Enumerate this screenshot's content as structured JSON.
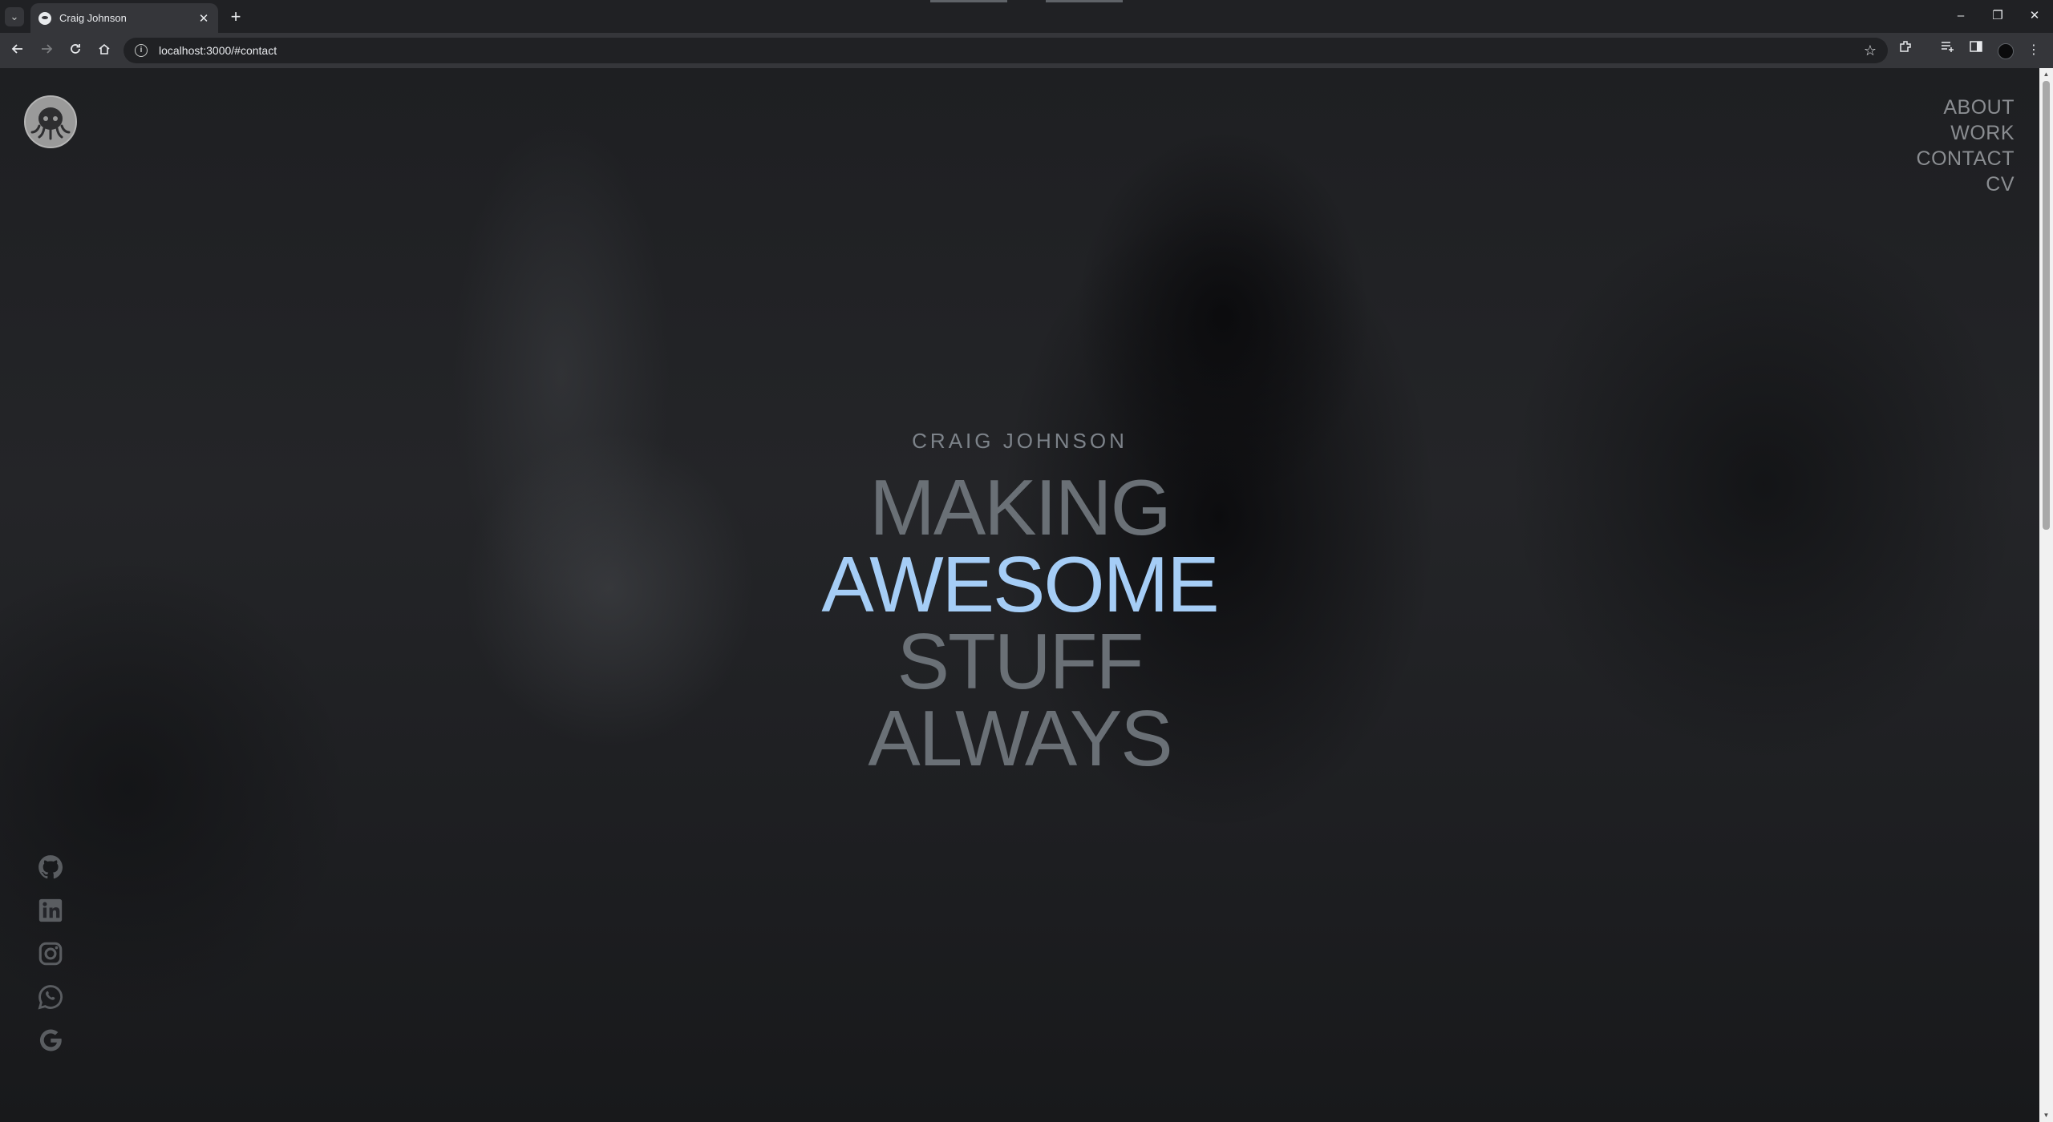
{
  "browser": {
    "tab_title": "Craig Johnson",
    "url": "localhost:3000/#contact",
    "tab_search_icon": "chevron-down-icon",
    "close_tab_symbol": "✕",
    "new_tab_symbol": "+",
    "window_controls": [
      "–",
      "❐",
      "✕"
    ]
  },
  "site": {
    "logo_icon": "octopus-logo-icon",
    "nav": [
      "ABOUT",
      "WORK",
      "CONTACT",
      "CV"
    ],
    "hero": {
      "name": "CRAIG JOHNSON",
      "lines": [
        "MAKING",
        "AWESOME",
        "STUFF",
        "ALWAYS"
      ],
      "accent_color": "#a5cdf6",
      "text_color": "#6a7076"
    },
    "social_icons": [
      "github-icon",
      "linkedin-icon",
      "instagram-icon",
      "whatsapp-icon",
      "google-icon"
    ]
  }
}
